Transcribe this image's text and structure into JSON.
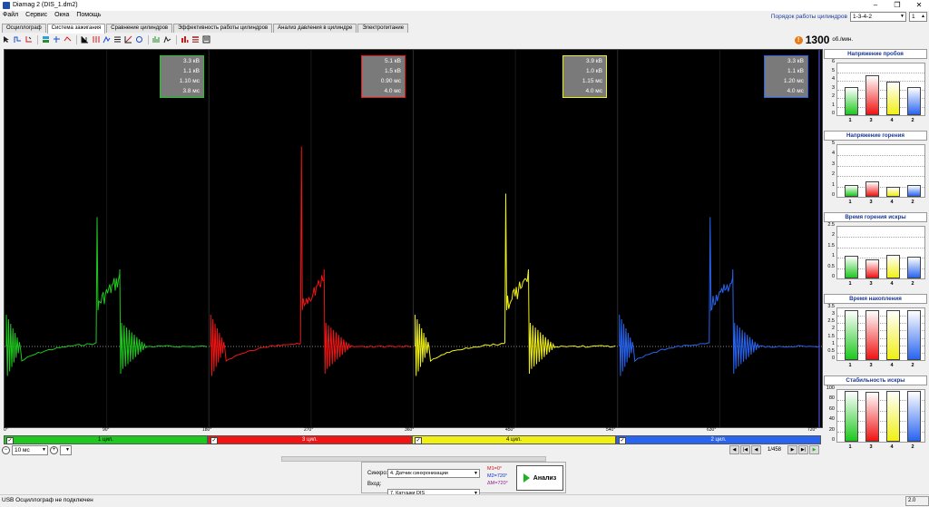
{
  "window": {
    "title": "Diamag 2 (DIS_1.dm2)",
    "controls": [
      "–",
      "❐",
      "✕"
    ]
  },
  "menu": [
    "Файл",
    "Сервис",
    "Окна",
    "Помощь"
  ],
  "firing_order": {
    "label": "Порядок работы цилиндров",
    "value": "1-3-4-2",
    "page": "1"
  },
  "tabs": [
    "Осциллограф",
    "Система зажигания",
    "Сравнение цилиндров",
    "Эффективность работы цилиндров",
    "Анализ давления в цилиндре",
    "Электропитание"
  ],
  "active_tab": 1,
  "rpm": {
    "value": "1300",
    "unit": "об./мин."
  },
  "cylinders": [
    {
      "name": "1 цил.",
      "color": "#1ec81e",
      "lines": [
        "3.3 кВ",
        "1.1 кВ",
        "1.10 мс",
        "3.8 мс"
      ]
    },
    {
      "name": "3 цил.",
      "color": "#f01414",
      "lines": [
        "5.1 кВ",
        "1.5 кВ",
        "0.90 мс",
        "4.0 мс"
      ]
    },
    {
      "name": "4 цил.",
      "color": "#f0f014",
      "lines": [
        "3.9 кВ",
        "1.0 кВ",
        "1.15 мс",
        "4.0 мс"
      ]
    },
    {
      "name": "2 цил.",
      "color": "#2864f0",
      "lines": [
        "3.3 кВ",
        "1.1 кВ",
        "1.20 мс",
        "4.0 мс"
      ]
    }
  ],
  "angle_ticks": [
    "0°",
    "90°",
    "180°",
    "270°",
    "360°",
    "450°",
    "540°",
    "630°",
    "720°"
  ],
  "time_div": "10 мс",
  "pager": "1/458",
  "sync": {
    "label": "Синхро:",
    "value": "4. Датчик синхронизации"
  },
  "input": {
    "label": "Вход:",
    "value": "7. Катушки DIS"
  },
  "markers": [
    {
      "text": "M1=0°",
      "color": "#d01010"
    },
    {
      "text": "M2=720°",
      "color": "#1030d0"
    },
    {
      "text": "ΔM=720°",
      "color": "#8a208a"
    }
  ],
  "analyze_label": "Анализ",
  "status": "USB Осциллограф не подключен",
  "version": "2.0",
  "metrics": [
    {
      "title": "Напряжение пробоя",
      "ymax": 6,
      "yticks": [
        "6",
        "5",
        "4",
        "3",
        "2",
        "1",
        "0"
      ],
      "values": [
        3.3,
        4.6,
        3.9,
        3.3
      ]
    },
    {
      "title": "Напряжение горения",
      "ymax": 5,
      "yticks": [
        "5",
        "4",
        "3",
        "2",
        "1",
        "0"
      ],
      "values": [
        1.1,
        1.5,
        1.0,
        1.1
      ]
    },
    {
      "title": "Время горения искры",
      "ymax": 2.5,
      "yticks": [
        "2.5",
        "2",
        "1.5",
        "1",
        "0.5",
        "0"
      ],
      "values": [
        1.1,
        0.9,
        1.15,
        1.05
      ]
    },
    {
      "title": "Время накопления",
      "ymax": 3.5,
      "yticks": [
        "3.5",
        "3",
        "2.5",
        "2",
        "1.5",
        "1",
        "0.5",
        "0"
      ],
      "values": [
        3.4,
        3.4,
        3.4,
        3.4
      ]
    },
    {
      "title": "Стабильность искры",
      "ymax": 100,
      "yticks": [
        "100",
        "80",
        "60",
        "40",
        "20",
        "0"
      ],
      "values": [
        98,
        96,
        98,
        98
      ]
    }
  ],
  "metric_x_labels": [
    "1",
    "3",
    "4",
    "2"
  ]
}
